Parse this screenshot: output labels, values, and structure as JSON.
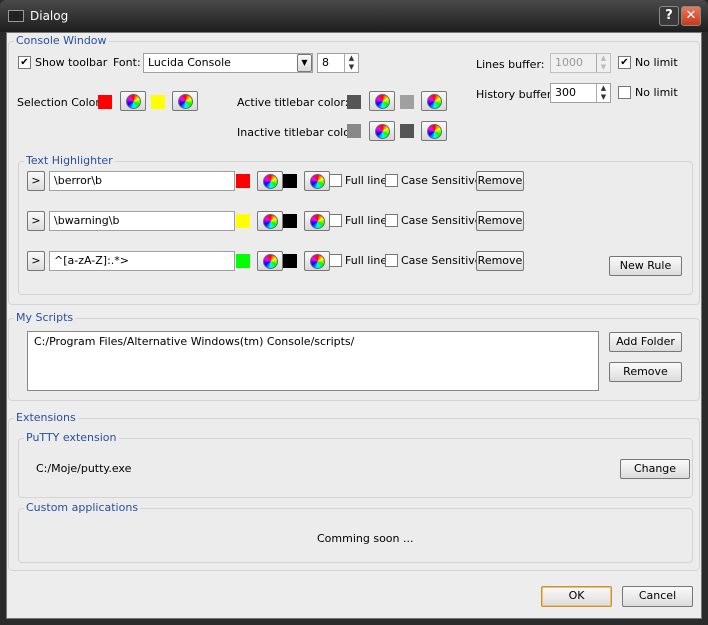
{
  "window": {
    "title": "Dialog",
    "help": "?",
    "close": "✕"
  },
  "console": {
    "label": "Console Window",
    "show_toolbar": "Show toolbar",
    "show_toolbar_checked": true,
    "font_label": "Font:",
    "font_value": "Lucida Console",
    "font_size": "8",
    "selection_label": "Selection Color:",
    "selection_colors": [
      "#ff0000",
      "#ffff00"
    ],
    "active_label": "Active titlebar color:",
    "active_colors": [
      "#555555",
      "#a0a0a0"
    ],
    "inactive_label": "Inactive titlebar color:",
    "inactive_colors": [
      "#888888",
      "#555555"
    ],
    "lines_label": "Lines buffer:",
    "lines_value": "1000",
    "lines_nolimit": "No limit",
    "lines_nolimit_checked": true,
    "history_label": "History buffer:",
    "history_value": "300",
    "history_nolimit": "No limit",
    "history_nolimit_checked": false
  },
  "highlighter": {
    "label": "Text Highlighter",
    "expand": ">",
    "full_line": "Full line",
    "case_sensitive": "Case Sensitive",
    "remove": "Remove",
    "new_rule": "New Rule",
    "rules": [
      {
        "pattern": "\\berror\\b",
        "fg": "#ff0000",
        "bg": "#000000"
      },
      {
        "pattern": "\\bwarning\\b",
        "fg": "#ffff00",
        "bg": "#000000"
      },
      {
        "pattern": "^[a-zA-Z]:.*>",
        "fg": "#00ff00",
        "bg": "#000000"
      }
    ]
  },
  "scripts": {
    "label": "My Scripts",
    "items": [
      "C:/Program Files/Alternative Windows(tm) Console/scripts/"
    ],
    "add_folder": "Add Folder",
    "remove": "Remove"
  },
  "extensions": {
    "label": "Extensions",
    "putty_label": "PuTTY extension",
    "putty_path": "C:/Moje/putty.exe",
    "change": "Change",
    "custom_label": "Custom applications",
    "custom_text": "Comming soon ..."
  },
  "footer": {
    "ok": "OK",
    "cancel": "Cancel"
  }
}
